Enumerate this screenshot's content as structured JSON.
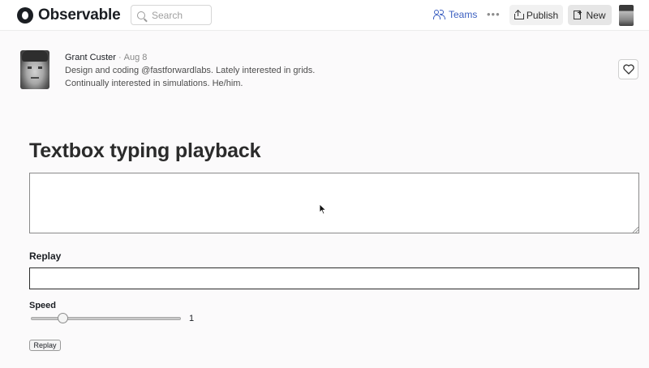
{
  "header": {
    "logo_text": "Observable",
    "search_placeholder": "Search",
    "teams_label": "Teams",
    "more_label": "•••",
    "publish_label": "Publish",
    "new_label": "New"
  },
  "author": {
    "name": "Grant Custer",
    "separator": "·",
    "date": "Aug 8",
    "bio_line1": "Design and coding @fastforwardlabs. Lately interested in grids.",
    "bio_line2": "Continually interested in simulations. He/him."
  },
  "notebook": {
    "title": "Textbox typing playback",
    "textbox_value": "",
    "replay_label": "Replay",
    "replay_value": "",
    "speed_label": "Speed",
    "speed_value": "1",
    "replay_button": "Replay"
  },
  "colors": {
    "accent": "#3b5fc0",
    "background": "#fbfafb"
  }
}
